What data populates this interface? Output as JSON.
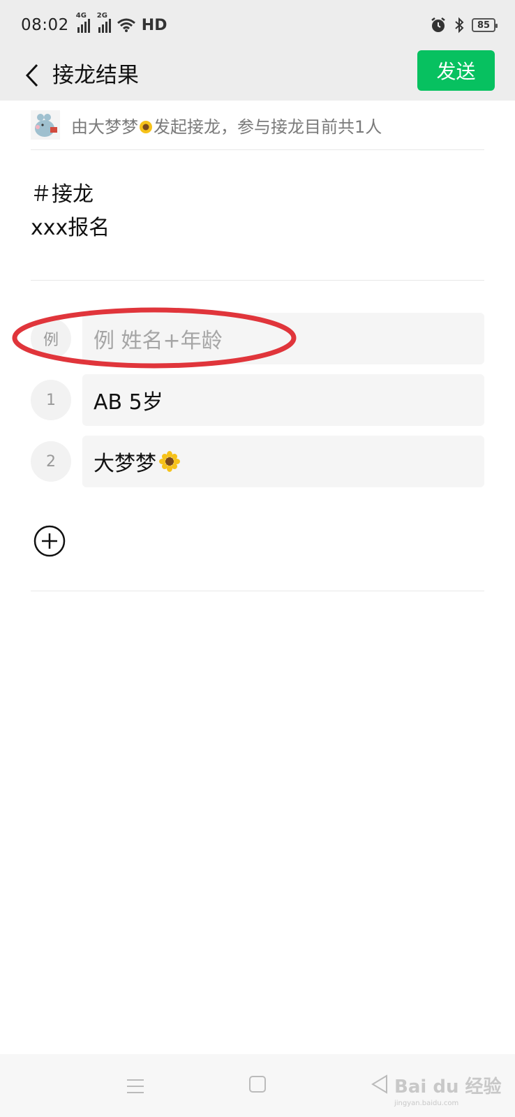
{
  "status_bar": {
    "time": "08:02",
    "sig1": "4G",
    "sig2": "2G",
    "hd": "HD",
    "battery": "85"
  },
  "nav": {
    "title": "接龙结果",
    "send_label": "发送"
  },
  "initiator": {
    "text_before": "由大梦梦",
    "text_after": "发起接龙，参与接龙目前共1人"
  },
  "topic": {
    "line1": "＃接龙",
    "line2": "xxx报名"
  },
  "example": {
    "badge": "例",
    "placeholder": "例 姓名+年龄"
  },
  "entries": [
    {
      "num": "1",
      "text": "AB 5岁"
    },
    {
      "num": "2",
      "text": "大梦梦"
    }
  ],
  "watermark": {
    "text": "Bai du 经验",
    "sub": "jingyan.baidu.com"
  },
  "colors": {
    "accent": "#07c160",
    "annotation": "#e0353b"
  }
}
